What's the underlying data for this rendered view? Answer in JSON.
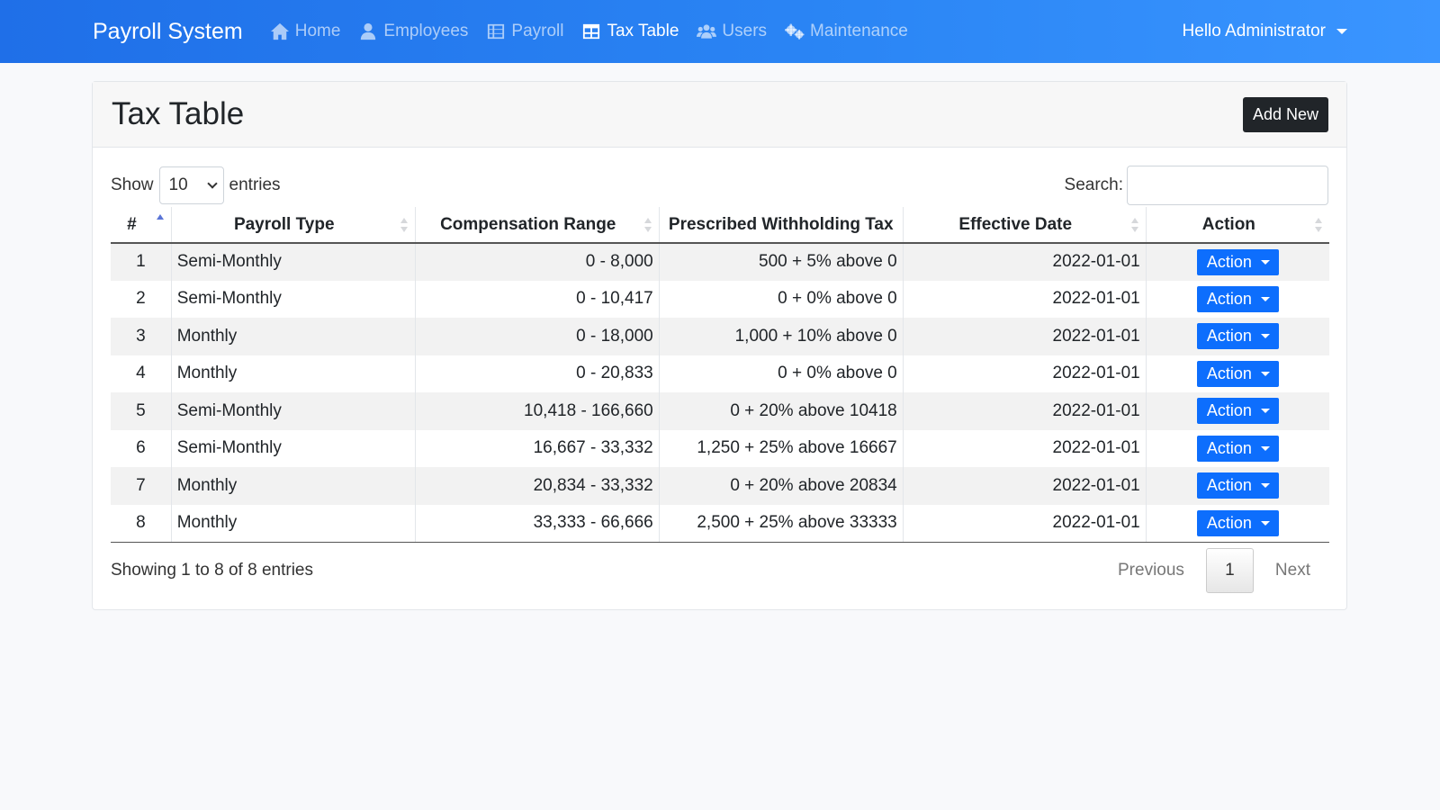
{
  "navbar": {
    "brand": "Payroll System",
    "items": [
      {
        "label": "Home",
        "icon": "home-icon",
        "active": false
      },
      {
        "label": "Employees",
        "icon": "user-icon",
        "active": false
      },
      {
        "label": "Payroll",
        "icon": "table-list-icon",
        "active": false
      },
      {
        "label": "Tax Table",
        "icon": "table-icon",
        "active": true
      },
      {
        "label": "Users",
        "icon": "users-icon",
        "active": false
      },
      {
        "label": "Maintenance",
        "icon": "cogs-icon",
        "active": false
      }
    ],
    "user_greeting": "Hello Administrator"
  },
  "page": {
    "title": "Tax Table",
    "add_new_label": "Add New"
  },
  "table_controls": {
    "show_label": "Show",
    "entries_label": "entries",
    "page_length": "10",
    "search_label": "Search:",
    "search_value": ""
  },
  "table": {
    "columns": [
      "#",
      "Payroll Type",
      "Compensation Range",
      "Prescribed Withholding Tax",
      "Effective Date",
      "Action"
    ],
    "rows": [
      {
        "num": "1",
        "type": "Semi-Monthly",
        "range": "0 - 8,000",
        "tax": "500 + 5% above 0",
        "date": "2022-01-01",
        "action": "Action"
      },
      {
        "num": "2",
        "type": "Semi-Monthly",
        "range": "0 - 10,417",
        "tax": "0 + 0% above 0",
        "date": "2022-01-01",
        "action": "Action"
      },
      {
        "num": "3",
        "type": "Monthly",
        "range": "0 - 18,000",
        "tax": "1,000 + 10% above 0",
        "date": "2022-01-01",
        "action": "Action"
      },
      {
        "num": "4",
        "type": "Monthly",
        "range": "0 - 20,833",
        "tax": "0 + 0% above 0",
        "date": "2022-01-01",
        "action": "Action"
      },
      {
        "num": "5",
        "type": "Semi-Monthly",
        "range": "10,418 - 166,660",
        "tax": "0 + 20% above 10418",
        "date": "2022-01-01",
        "action": "Action"
      },
      {
        "num": "6",
        "type": "Semi-Monthly",
        "range": "16,667 - 33,332",
        "tax": "1,250 + 25% above 16667",
        "date": "2022-01-01",
        "action": "Action"
      },
      {
        "num": "7",
        "type": "Monthly",
        "range": "20,834 - 33,332",
        "tax": "0 + 20% above 20834",
        "date": "2022-01-01",
        "action": "Action"
      },
      {
        "num": "8",
        "type": "Monthly",
        "range": "33,333 - 66,666",
        "tax": "2,500 + 25% above 33333",
        "date": "2022-01-01",
        "action": "Action"
      }
    ]
  },
  "footer": {
    "info": "Showing 1 to 8 of 8 entries",
    "previous": "Previous",
    "current_page": "1",
    "next": "Next"
  },
  "colors": {
    "navbar_accent": "#2b86f5",
    "action_button": "#0d6efd",
    "add_new_button": "#212529"
  }
}
